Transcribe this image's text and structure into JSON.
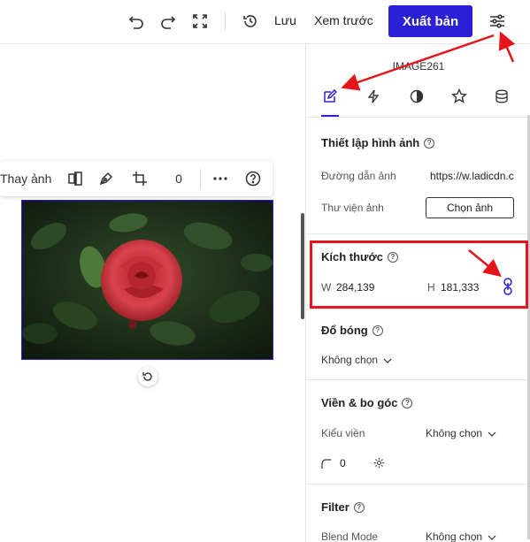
{
  "topbar": {
    "save_label": "Lưu",
    "preview_label": "Xem trước",
    "publish_label": "Xuất bản"
  },
  "image_toolbar": {
    "replace_label": "Thay ảnh",
    "count_value": "0"
  },
  "panel": {
    "element_name": "IMAGE261",
    "tabs": [
      "edit",
      "events",
      "style",
      "effects",
      "data"
    ],
    "image_settings": {
      "title": "Thiết lập hình ảnh",
      "path_label": "Đường dẫn ảnh",
      "path_value": "https://w.ladicdn.c",
      "library_label": "Thư viện ảnh",
      "choose_button": "Chọn ảnh"
    },
    "size": {
      "title": "Kích thước",
      "w_label": "W",
      "w_value": "284,139",
      "h_label": "H",
      "h_value": "181,333"
    },
    "shadow": {
      "title": "Đổ bóng",
      "value": "Không chọn"
    },
    "border": {
      "title": "Viền & bo góc",
      "style_label": "Kiểu viền",
      "style_value": "Không chọn",
      "radius_value": "0"
    },
    "filter": {
      "title": "Filter",
      "blend_label": "Blend Mode",
      "blend_value": "Không chọn"
    }
  },
  "colors": {
    "accent": "#2b20d6",
    "highlight": "#e4161b"
  }
}
